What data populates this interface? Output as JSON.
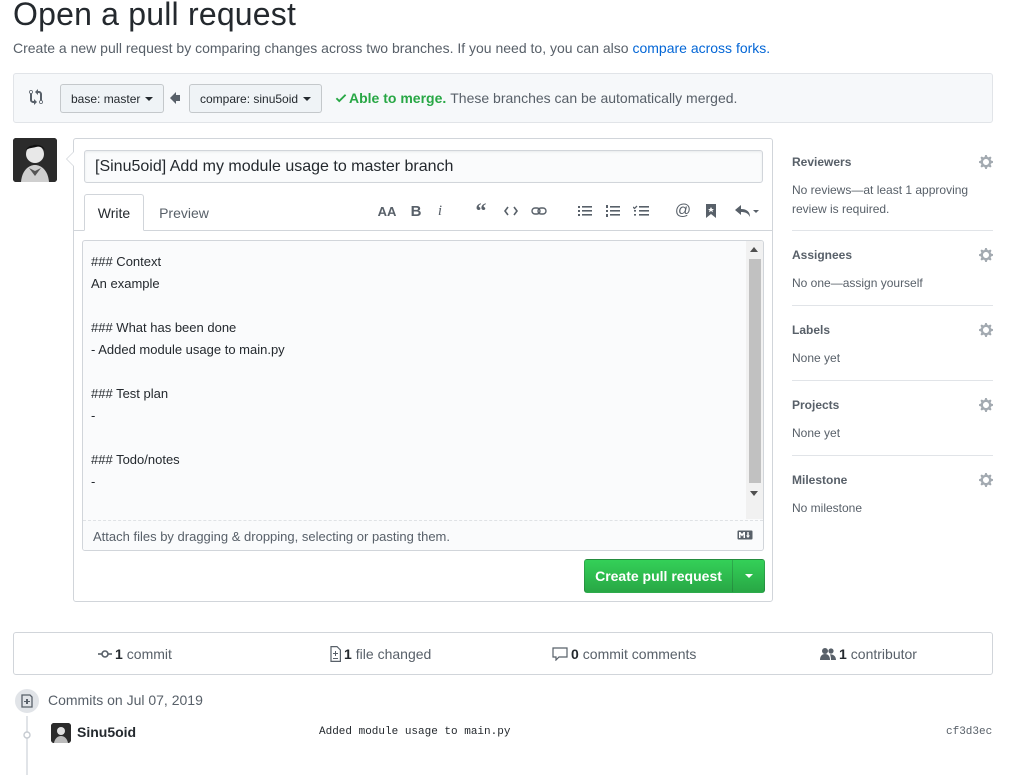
{
  "page": {
    "title": "Open a pull request",
    "subtitle": "Create a new pull request by comparing changes across two branches. If you need to, you can also",
    "subtitle_link": "compare across forks."
  },
  "range": {
    "base_label": "base: master",
    "compare_label": "compare: sinu5oid",
    "merge_status_strong": "Able to merge.",
    "merge_status_text": "These branches can be automatically merged.",
    "status_color": "#28a745"
  },
  "form": {
    "title_value": "[Sinu5oid] Add my module usage to master branch",
    "tabs": [
      "Write",
      "Preview"
    ],
    "body_lines": [
      "### Context",
      "An example",
      "",
      "### What has been done",
      "- Added module usage to main.py",
      "",
      "### Test plan",
      "-",
      "",
      "### Todo/notes",
      "-"
    ],
    "attach_hint": "Attach files by dragging & dropping, selecting or pasting them.",
    "submit_label": "Create pull request",
    "toolbar_icons": [
      "header-icon",
      "bold-icon",
      "italic-icon",
      "quote-icon",
      "code-icon",
      "link-icon",
      "bulleted-list-icon",
      "numbered-list-icon",
      "task-list-icon",
      "mention-icon",
      "saved-reply-icon",
      "reply-icon"
    ]
  },
  "sidebar": {
    "reviewers": {
      "label": "Reviewers",
      "value": "No reviews—at least 1 approving review is required."
    },
    "assignees": {
      "label": "Assignees",
      "value": "No one—assign yourself"
    },
    "labels": {
      "label": "Labels",
      "value": "None yet"
    },
    "projects": {
      "label": "Projects",
      "value": "None yet"
    },
    "milestone": {
      "label": "Milestone",
      "value": "No milestone"
    }
  },
  "summary": {
    "commits_count": "1",
    "commits_label": "commit",
    "files_count": "1",
    "files_label": "file changed",
    "comments_count": "0",
    "comments_label": "commit comments",
    "contributors_count": "1",
    "contributors_label": "contributor"
  },
  "commits": {
    "date_heading": "Commits on Jul 07, 2019",
    "items": [
      {
        "author": "Sinu5oid",
        "message": "Added module usage to main.py",
        "sha": "cf3d3ec"
      }
    ]
  },
  "colors": {
    "link": "#0366d6",
    "primary_button": "#28a745",
    "text": "#24292e",
    "muted": "#586069"
  }
}
